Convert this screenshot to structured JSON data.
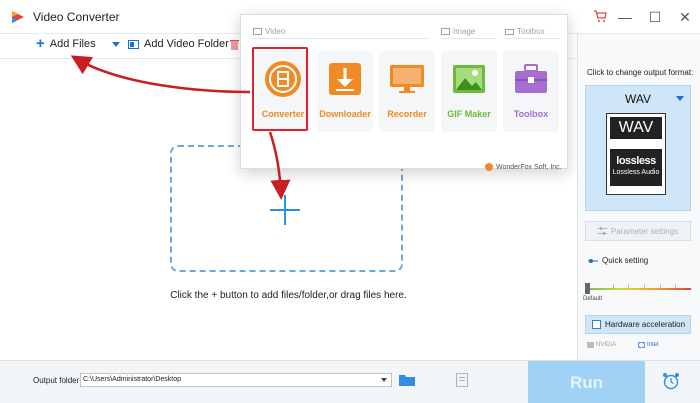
{
  "app": {
    "title": "Video Converter"
  },
  "window": {
    "minimize": "—",
    "maximize": "☐",
    "close": "✕"
  },
  "toolbar": {
    "add_files": "Add Files",
    "add_video_folder": "Add Video Folder"
  },
  "main": {
    "drop_hint": "Click the + button to add files/folder,or drag files here."
  },
  "popup": {
    "sections": {
      "video": "Video",
      "image": "Image",
      "toolbox": "Toolbox"
    },
    "modules": [
      {
        "label": "Converter",
        "color": "#f08a24",
        "icon": "film-reel-icon"
      },
      {
        "label": "Downloader",
        "color": "#f08a24",
        "icon": "download-icon"
      },
      {
        "label": "Recorder",
        "color": "#f08a24",
        "icon": "monitor-icon"
      },
      {
        "label": "GIF Maker",
        "color": "#6dbb3a",
        "icon": "image-icon"
      },
      {
        "label": "Toolbox",
        "color": "#a56fd0",
        "icon": "toolbox-icon"
      }
    ],
    "brand": "WonderFox Soft, Inc."
  },
  "output_panel": {
    "hint": "Click to change output format:",
    "format": "WAV",
    "icon_top": "WAV",
    "icon_lossless": "lossless",
    "icon_caption": "Lossless Audio",
    "parameter_settings": "Parameter settings",
    "quick_setting": "Quick setting",
    "default_label": "Default",
    "hardware_acceleration": "Hardware acceleration",
    "vendors": [
      "NVIDIA",
      "Intel"
    ]
  },
  "bottom": {
    "output_folder_label": "Output folder:",
    "output_folder_value": "C:\\Users\\Administrator\\Desktop",
    "run": "Run"
  },
  "colors": {
    "accent": "#1a6fd0",
    "highlight": "#e0202a",
    "run": "#9fd2f5",
    "format_box": "#cfe6f8"
  }
}
